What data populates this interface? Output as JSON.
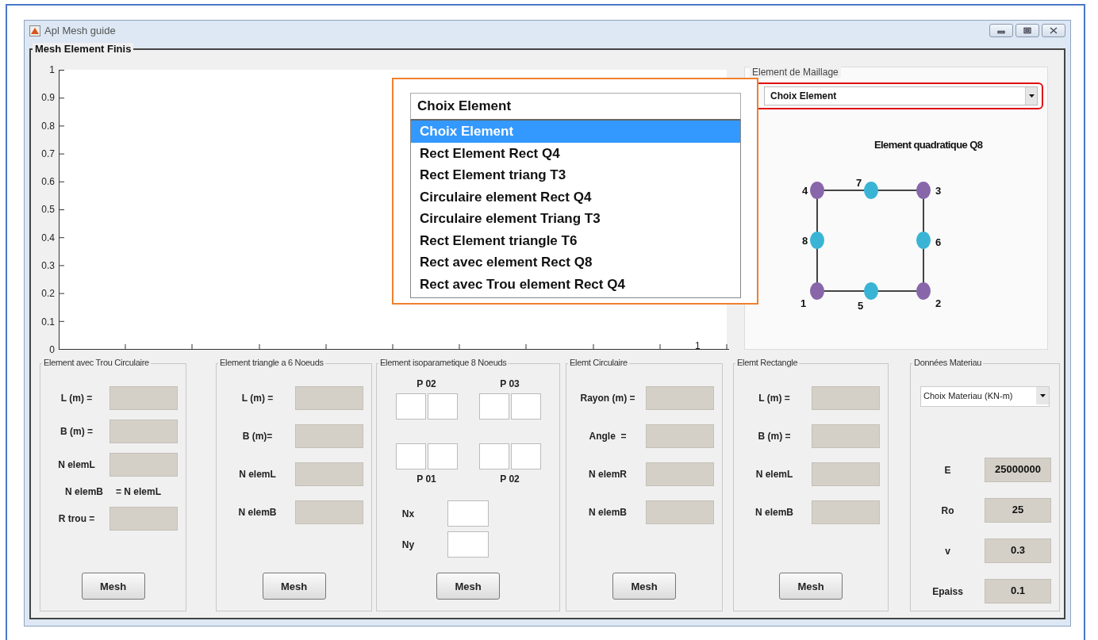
{
  "window": {
    "title": "Apl Mesh guide"
  },
  "main_panel": {
    "title": "Mesh Element Finis"
  },
  "axes": {
    "y_tick_labels": [
      "1",
      "0.9",
      "0.8",
      "0.7",
      "0.6",
      "0.5",
      "0.4",
      "0.3",
      "0.2",
      "0.1",
      "0"
    ],
    "x_tick_labels": [
      "1"
    ]
  },
  "element_menu": {
    "value": "Choix Element",
    "options": [
      {
        "label": "Choix Element",
        "selected": true
      },
      {
        "label": "Rect Element Rect Q4",
        "selected": false
      },
      {
        "label": "Rect Element triang T3",
        "selected": false
      },
      {
        "label": "Circulaire element Rect Q4",
        "selected": false
      },
      {
        "label": "Circulaire element Triang T3",
        "selected": false
      },
      {
        "label": "Rect Element triangle T6",
        "selected": false
      },
      {
        "label": "Rect avec element Rect Q8",
        "selected": false
      },
      {
        "label": "Rect avec Trou element Rect Q4",
        "selected": false
      }
    ]
  },
  "mesh_element_panel": {
    "title": "Element de Maillage",
    "popup": {
      "value": "Choix Element"
    },
    "diagram": {
      "title": "Element quadratique Q8",
      "nodes": [
        {
          "label": "4",
          "kind": "corner"
        },
        {
          "label": "7",
          "kind": "mid"
        },
        {
          "label": "3",
          "kind": "corner"
        },
        {
          "label": "8",
          "kind": "mid"
        },
        {
          "label": "6",
          "kind": "mid"
        },
        {
          "label": "1",
          "kind": "corner"
        },
        {
          "label": "5",
          "kind": "mid"
        },
        {
          "label": "2",
          "kind": "corner"
        }
      ]
    }
  },
  "panels": [
    {
      "kind": "fields",
      "title": "Element avec Trou Circulaire",
      "rows": [
        {
          "kind": "field",
          "label": "L (m) =",
          "disabled": true
        },
        {
          "kind": "field",
          "label": "B (m) =",
          "disabled": true
        },
        {
          "kind": "field",
          "label": "N elemL",
          "disabled": true
        },
        {
          "kind": "relation",
          "label": "N elemB",
          "text": "= N elemL"
        },
        {
          "kind": "field",
          "label": "R trou =",
          "disabled": true
        }
      ],
      "button": "Mesh"
    },
    {
      "kind": "fields",
      "title": "Element triangle a 6 Noeuds",
      "rows": [
        {
          "kind": "field",
          "label": "L (m) =",
          "disabled": true
        },
        {
          "kind": "field",
          "label": "B (m)=",
          "disabled": true
        },
        {
          "kind": "field",
          "label": "N elemL",
          "disabled": true
        },
        {
          "kind": "field",
          "label": "N elemB",
          "disabled": true
        }
      ],
      "button": "Mesh"
    },
    {
      "kind": "points",
      "title": "Element isoparametique 8 Noeuds",
      "points": [
        "P 02",
        "P 03",
        "P 01",
        "P 02"
      ],
      "rows": [
        {
          "kind": "field",
          "label": "Nx",
          "disabled": false
        },
        {
          "kind": "field",
          "label": "Ny",
          "disabled": false
        }
      ],
      "button": "Mesh"
    },
    {
      "kind": "fields",
      "title": "Elemt Circulaire",
      "rows": [
        {
          "kind": "field",
          "label": "Rayon (m) =",
          "disabled": true
        },
        {
          "kind": "field",
          "label": "Angle  =",
          "disabled": true
        },
        {
          "kind": "field",
          "label": "N elemR",
          "disabled": true
        },
        {
          "kind": "field",
          "label": "N elemB",
          "disabled": true
        }
      ],
      "button": "Mesh"
    },
    {
      "kind": "fields",
      "title": "Elemt Rectangle",
      "rows": [
        {
          "kind": "field",
          "label": "L (m) =",
          "disabled": true
        },
        {
          "kind": "field",
          "label": "B (m) =",
          "disabled": true
        },
        {
          "kind": "field",
          "label": "N elemL",
          "disabled": true
        },
        {
          "kind": "field",
          "label": "N elemB",
          "disabled": true
        }
      ],
      "button": "Mesh"
    },
    {
      "kind": "material",
      "title": "Données Materiau",
      "popup": "Choix Materiau (KN-m)",
      "rows": [
        {
          "kind": "value",
          "label": "E",
          "value": "25000000",
          "disabled": true
        },
        {
          "kind": "value",
          "label": "Ro",
          "value": "25",
          "disabled": true
        },
        {
          "kind": "value",
          "label": "v",
          "value": "0.3",
          "disabled": true
        },
        {
          "kind": "value",
          "label": "Epaiss",
          "value": "0.1",
          "disabled": true
        }
      ]
    }
  ]
}
